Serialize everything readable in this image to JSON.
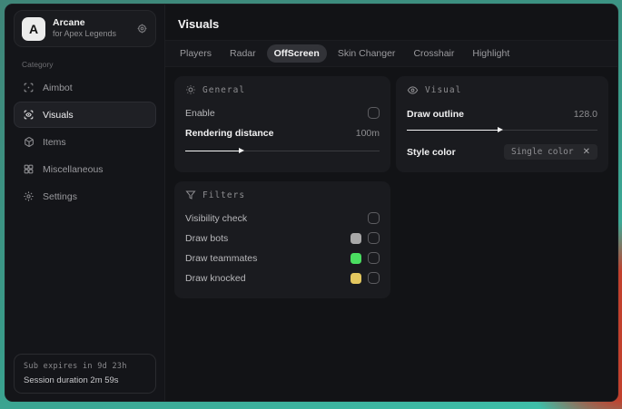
{
  "app": {
    "logo_letter": "A",
    "name": "Arcane",
    "subtitle": "for Apex Legends"
  },
  "sidebar": {
    "category_label": "Category",
    "items": [
      {
        "label": "Aimbot",
        "icon": "crosshair-icon"
      },
      {
        "label": "Visuals",
        "icon": "scan-eye-icon"
      },
      {
        "label": "Items",
        "icon": "package-icon"
      },
      {
        "label": "Miscellaneous",
        "icon": "grid-icon"
      },
      {
        "label": "Settings",
        "icon": "gear-icon"
      }
    ],
    "footer": {
      "line1": "Sub expires in 9d 23h",
      "line2": "Session duration 2m 59s"
    }
  },
  "header": {
    "title": "Visuals"
  },
  "tabs": [
    {
      "label": "Players"
    },
    {
      "label": "Radar"
    },
    {
      "label": "OffScreen"
    },
    {
      "label": "Skin Changer"
    },
    {
      "label": "Crosshair"
    },
    {
      "label": "Highlight"
    }
  ],
  "general_card": {
    "title": "General",
    "enable_label": "Enable",
    "rendering_label": "Rendering distance",
    "rendering_value": "100m",
    "rendering_fill_pct": 28
  },
  "visual_card": {
    "title": "Visual",
    "outline_label": "Draw outline",
    "outline_value": "128.0",
    "outline_fill_pct": 48,
    "style_label": "Style color",
    "style_value": "Single color",
    "style_clear": "✕"
  },
  "filters_card": {
    "title": "Filters",
    "rows": [
      {
        "label": "Visibility check",
        "swatch": null
      },
      {
        "label": "Draw bots",
        "swatch": "#a8a8a8"
      },
      {
        "label": "Draw teammates",
        "swatch": "#4ade61"
      },
      {
        "label": "Draw knocked",
        "swatch": "#e3c75f"
      }
    ]
  }
}
